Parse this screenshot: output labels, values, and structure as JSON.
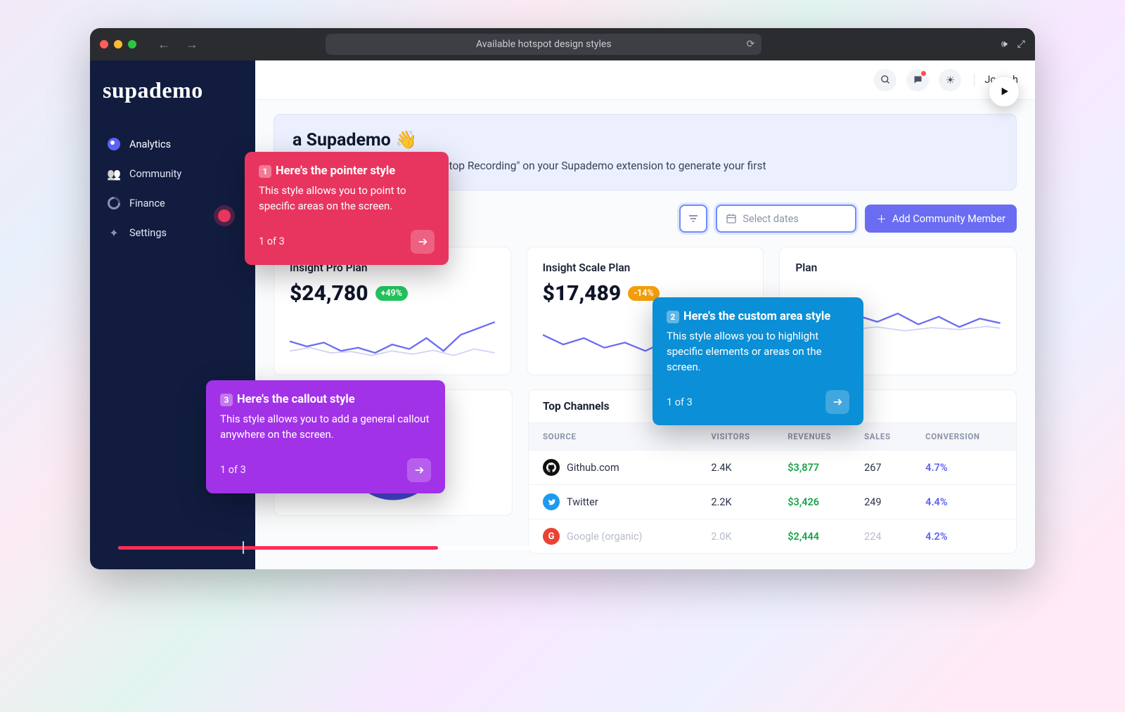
{
  "browser": {
    "title": "Available hotspot design styles"
  },
  "brand": "supademo",
  "sidebar": {
    "items": [
      {
        "label": "Analytics"
      },
      {
        "label": "Community"
      },
      {
        "label": "Finance"
      },
      {
        "label": "Settings"
      }
    ]
  },
  "topbar": {
    "user": "Joseph"
  },
  "banner": {
    "title_suffix": "a Supademo 👋",
    "body_suffix": "board. Once you're done, click \"Stop Recording\" on your Supademo extension to generate your first"
  },
  "controls": {
    "date_placeholder": "Select dates",
    "primary": "Add Community Member"
  },
  "cards": [
    {
      "title": "Insight Pro Plan",
      "value": "$24,780",
      "delta": "+49%",
      "dir": "up"
    },
    {
      "title": "Insight Scale Plan",
      "value": "$17,489",
      "delta": "-14%",
      "dir": "down"
    },
    {
      "title": "Plan",
      "value": "",
      "delta": "",
      "dir": ""
    }
  ],
  "channels": {
    "title": "Top Channels",
    "headers": {
      "source": "SOURCE",
      "visitors": "VISITORS",
      "revenues": "REVENUES",
      "sales": "SALES",
      "conversion": "CONVERSION"
    },
    "rows": [
      {
        "source": "Github.com",
        "visitors": "2.4K",
        "revenue": "$3,877",
        "sales": "267",
        "conversion": "4.7%",
        "icon_bg": "#111",
        "icon_txt": ""
      },
      {
        "source": "Twitter",
        "visitors": "2.2K",
        "revenue": "$3,426",
        "sales": "249",
        "conversion": "4.4%",
        "icon_bg": "#1d9bf0",
        "icon_txt": ""
      },
      {
        "source": "Google (organic)",
        "visitors": "2.0K",
        "revenue": "$2,444",
        "sales": "224",
        "conversion": "4.2%",
        "icon_bg": "#ea4335",
        "icon_txt": "G"
      }
    ]
  },
  "callouts": {
    "c1": {
      "num": "1",
      "title": "Here's the pointer style",
      "body": "This style allows you to point to specific areas on the screen.",
      "step": "1 of 3"
    },
    "c2": {
      "num": "2",
      "title": "Here's the custom area style",
      "body": "This style allows you to highlight specific elements or areas on the screen.",
      "step": "1 of 3"
    },
    "c3": {
      "num": "3",
      "title": "Here's the callout style",
      "body": "This style allows you to add a general callout anywhere on the screen.",
      "step": "1 of 3"
    }
  },
  "progress_percent": 36
}
